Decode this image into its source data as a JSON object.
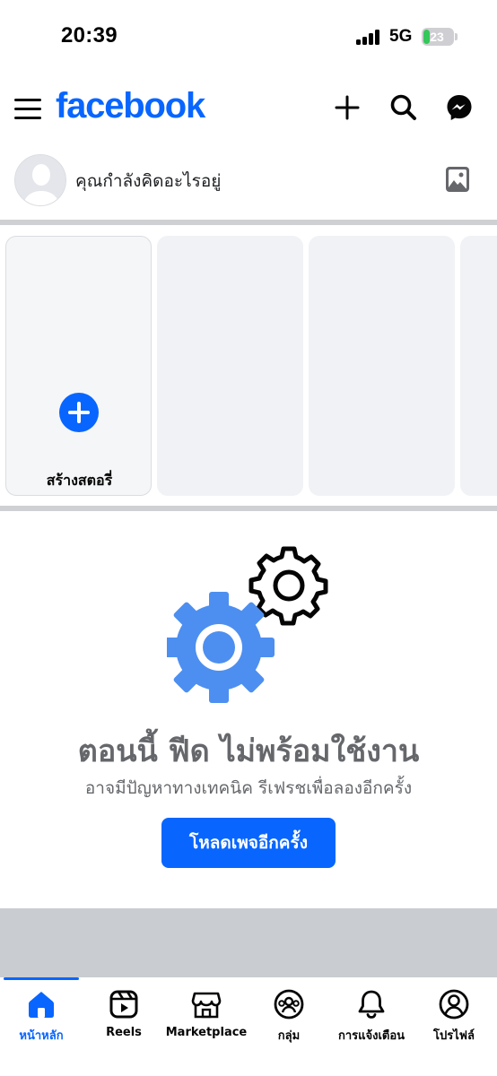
{
  "status_bar": {
    "time": "20:39",
    "network": "5G",
    "battery": "23",
    "battery_level": 0.23,
    "battery_charging": true
  },
  "header": {
    "logo_text": "facebook",
    "icons": [
      "menu-icon",
      "plus-icon",
      "search-icon",
      "messenger-icon"
    ]
  },
  "composer": {
    "placeholder": "คุณกำลังคิดอะไรอยู่",
    "icons": [
      "avatar-placeholder",
      "photo-icon"
    ]
  },
  "stories": {
    "create_label": "สร้างสตอรี่"
  },
  "feed_error": {
    "title": "ตอนนี้ ฟีด ไม่พร้อมใช้งาน",
    "subtitle": "อาจมีปัญหาทางเทคนิค รีเฟรชเพื่อลองอีกครั้ง",
    "button_label": "โหลดเพจอีกครั้ง",
    "icons": [
      "gears-illustration"
    ]
  },
  "tabs": [
    {
      "label": "หน้าหลัก",
      "icon": "home-icon",
      "active": true
    },
    {
      "label": "Reels",
      "icon": "reels-icon",
      "active": false
    },
    {
      "label": "Marketplace",
      "icon": "marketplace-icon",
      "active": false
    },
    {
      "label": "กลุ่ม",
      "icon": "groups-icon",
      "active": false
    },
    {
      "label": "การแจ้งเตือน",
      "icon": "bell-icon",
      "active": false
    },
    {
      "label": "โปรไฟล์",
      "icon": "profile-icon",
      "active": false
    }
  ],
  "colors": {
    "brand": "#0866ff",
    "text": "#050505",
    "secondary_text": "#65676b",
    "divider": "#ced0d4",
    "battery_fill": "#34c759"
  }
}
